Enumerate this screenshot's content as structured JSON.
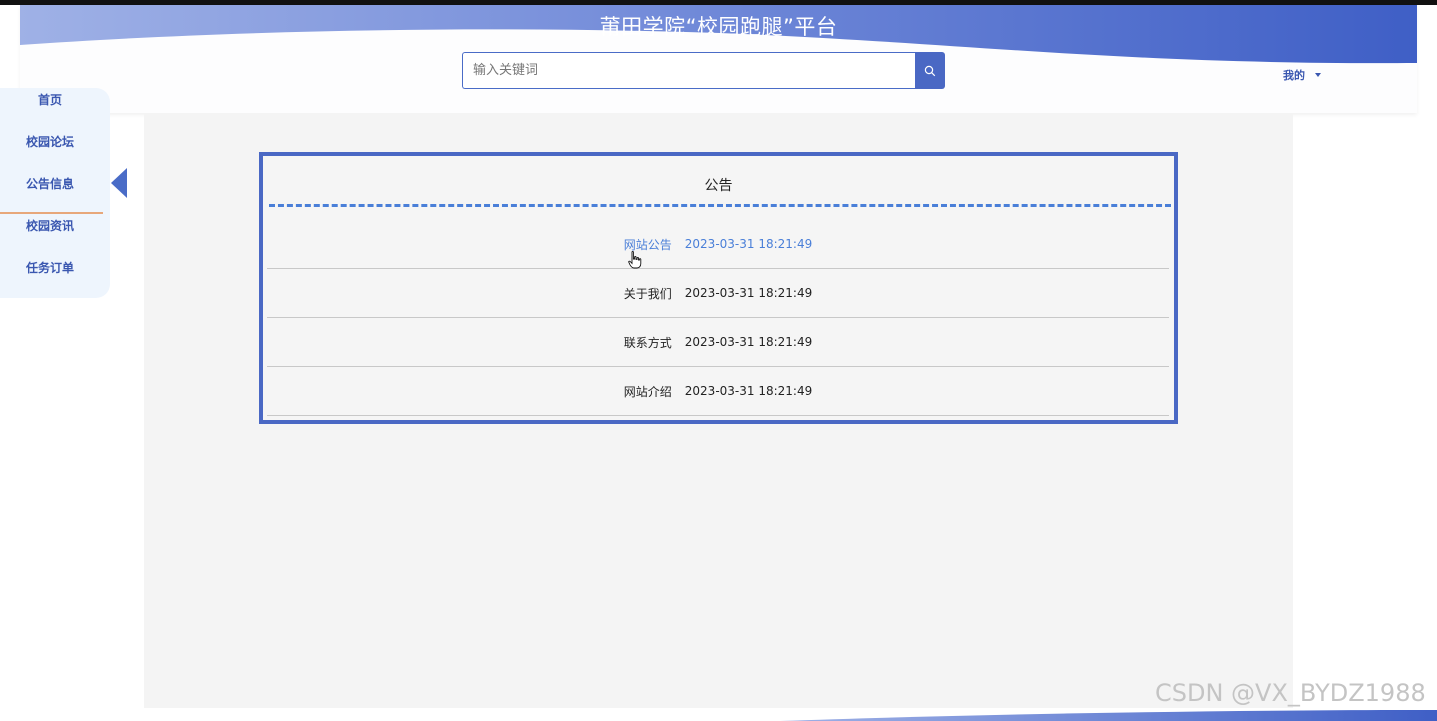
{
  "header": {
    "title": "莆田学院“校园跑腿”平台",
    "brand_color": "#4a68c4"
  },
  "search": {
    "placeholder": "输入关键词",
    "icon": "search-icon"
  },
  "user_menu": {
    "label": "我的",
    "icon": "caret-down-icon"
  },
  "sidebar": {
    "items": [
      {
        "label": "首页"
      },
      {
        "label": "校园论坛"
      },
      {
        "label": "公告信息",
        "active": true
      },
      {
        "label": "校园资讯"
      },
      {
        "label": "任务订单"
      }
    ]
  },
  "notice": {
    "title": "公告",
    "rows": [
      {
        "name": "网站公告",
        "time": "2023-03-31 18:21:49",
        "hovered": true
      },
      {
        "name": "关于我们",
        "time": "2023-03-31 18:21:49"
      },
      {
        "name": "联系方式",
        "time": "2023-03-31 18:21:49"
      },
      {
        "name": "网站介绍",
        "time": "2023-03-31 18:21:49"
      }
    ]
  },
  "watermark": "CSDN @VX_BYDZ1988"
}
